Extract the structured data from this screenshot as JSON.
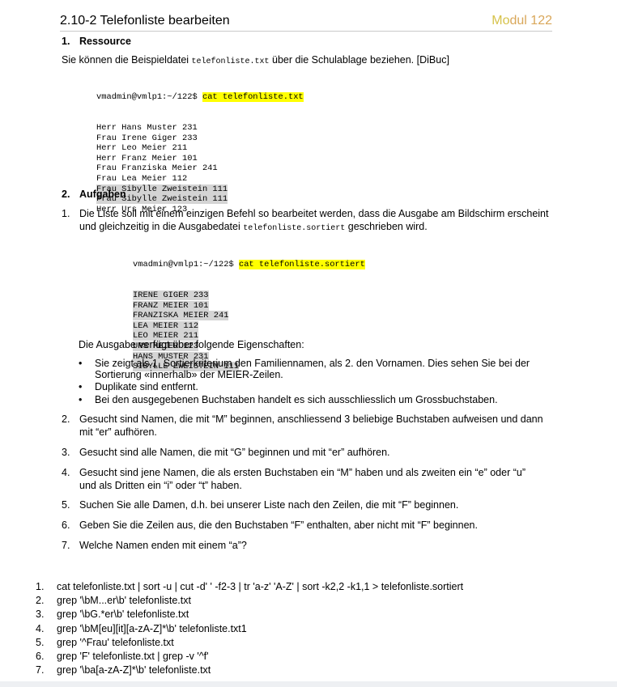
{
  "header": {
    "title": "2.10-2  Telefonliste bearbeiten",
    "module_part1": "Mo",
    "module_part2": "dul 122"
  },
  "section1": {
    "number": "1.",
    "heading": "Ressource",
    "text_before": "Sie können die Beispieldatei ",
    "filename": "telefonliste.txt",
    "text_after": " über die Schulablage beziehen. [DiBuc]"
  },
  "code1": {
    "prompt": "vmadmin@vmlp1:~/122$ ",
    "command": "cat telefonliste.txt",
    "lines": [
      {
        "text": "Herr Hans Muster 231",
        "shaded": false
      },
      {
        "text": "Frau Irene Giger 233",
        "shaded": false
      },
      {
        "text": "Herr Leo Meier 211",
        "shaded": false
      },
      {
        "text": "Herr Franz Meier 101",
        "shaded": false
      },
      {
        "text": "Frau Franziska Meier 241",
        "shaded": false
      },
      {
        "text": "Frau Lea Meier 112",
        "shaded": false
      },
      {
        "text": "Frau Sibylle Zweistein 111",
        "shaded": true
      },
      {
        "text": "Frau Sibylle Zweistein 111",
        "shaded": true
      },
      {
        "text": "Herr Urs Meier 123",
        "shaded": false
      }
    ]
  },
  "section2": {
    "number": "2.",
    "heading": "Aufgaben"
  },
  "task1": {
    "number": "1.",
    "line1": "Die Liste soll mit einem einzigen Befehl so bearbeitet werden, dass die Ausgabe am Bildschirm erscheint",
    "line2_before": "und gleichzeitig in die Ausgabedatei ",
    "line2_file": "telefonliste.sortiert",
    "line2_after": " geschrieben wird."
  },
  "code2": {
    "prompt": "vmadmin@vmlp1:~/122$ ",
    "command": "cat telefonliste.sortiert",
    "lines": [
      "IRENE GIGER 233",
      "FRANZ MEIER 101",
      "FRANZISKA MEIER 241",
      "LEA MEIER 112",
      "LEO MEIER 211",
      "URS MEIER 123",
      "HANS MUSTER 231",
      "SIBYLLE ZWEISTEIN 111"
    ]
  },
  "properties_intro": "Die Ausgabe verfügt über folgende Eigenschaften:",
  "bullets": [
    "Sie zeigt als 1. Sortierkriterium den Familiennamen, als 2. den Vornamen. Dies sehen Sie bei der Sortierung «innerhalb» der MEIER-Zeilen.",
    "Duplikate sind entfernt.",
    "Bei den ausgegebenen Buchstaben handelt es sich ausschliesslich um Grossbuchstaben."
  ],
  "tasks": [
    {
      "number": "2.",
      "line1": "Gesucht sind Namen, die mit “M” beginnen, anschliessend 3 beliebige Buchstaben aufweisen und dann",
      "line2": "mit “er” aufhören."
    },
    {
      "number": "3.",
      "line1": "Gesucht sind alle Namen, die mit “G” beginnen und mit “er” aufhören.",
      "line2": ""
    },
    {
      "number": "4.",
      "line1": "Gesucht sind jene Namen, die als ersten Buchstaben ein “M” haben und als zweiten ein “e” oder “u”",
      "line2": "und als Dritten ein “i” oder “t” haben."
    },
    {
      "number": "5.",
      "line1": "Suchen Sie alle Damen, d.h. bei unserer Liste nach den Zeilen, die mit “F” beginnen.",
      "line2": ""
    },
    {
      "number": "6.",
      "line1": "Geben Sie die Zeilen aus, die den Buchstaben “F” enthalten, aber nicht mit “F” beginnen.",
      "line2": ""
    },
    {
      "number": "7.",
      "line1": "Welche Namen enden mit einem “a”?",
      "line2": ""
    }
  ],
  "answers": [
    {
      "number": "1.",
      "text": "cat telefonliste.txt | sort -u | cut -d' ' -f2-3 | tr 'a-z' 'A-Z' | sort -k2,2 -k1,1 > telefonliste.sortiert"
    },
    {
      "number": "2.",
      "text": "grep '\\bM...er\\b' telefonliste.txt"
    },
    {
      "number": "3.",
      "text": "grep '\\bG.*er\\b' telefonliste.txt"
    },
    {
      "number": "4.",
      "text": "grep '\\bM[eu][it][a-zA-Z]*\\b' telefonliste.txt1"
    },
    {
      "number": "5.",
      "text": "grep '^Frau' telefonliste.txt"
    },
    {
      "number": "6.",
      "text": "grep 'F' telefonliste.txt | grep -v '^f'"
    },
    {
      "number": "7.",
      "text": "grep '\\ba[a-zA-Z]*\\b' telefonliste.txt"
    }
  ]
}
